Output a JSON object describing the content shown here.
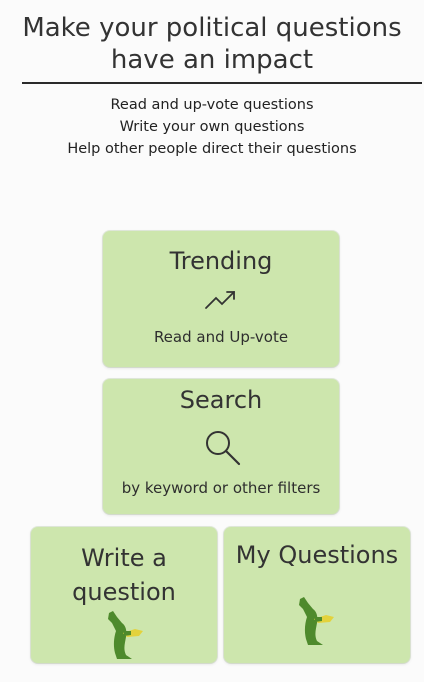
{
  "header": {
    "title_line1": "Make your political questions",
    "title_line2": "have an impact"
  },
  "intro": {
    "line1": "Read and up-vote questions",
    "line2": "Write your own questions",
    "line3": "Help other people direct their questions"
  },
  "cards": {
    "trending": {
      "title": "Trending",
      "subtitle": "Read and Up-vote",
      "icon": "trending-up-icon"
    },
    "search": {
      "title": "Search",
      "subtitle": "by keyword or other filters",
      "icon": "search-icon"
    },
    "write": {
      "title_line1": "Write a",
      "title_line2": "question",
      "icon": "kangaroo-icon"
    },
    "my_questions": {
      "title": "My Questions",
      "icon": "kangaroo-icon"
    }
  },
  "colors": {
    "card_background": "#cde6ad",
    "kangaroo": "#4e8a2c",
    "kangaroo_accent": "#e3d23c",
    "page_background": "#fbfbfb"
  }
}
